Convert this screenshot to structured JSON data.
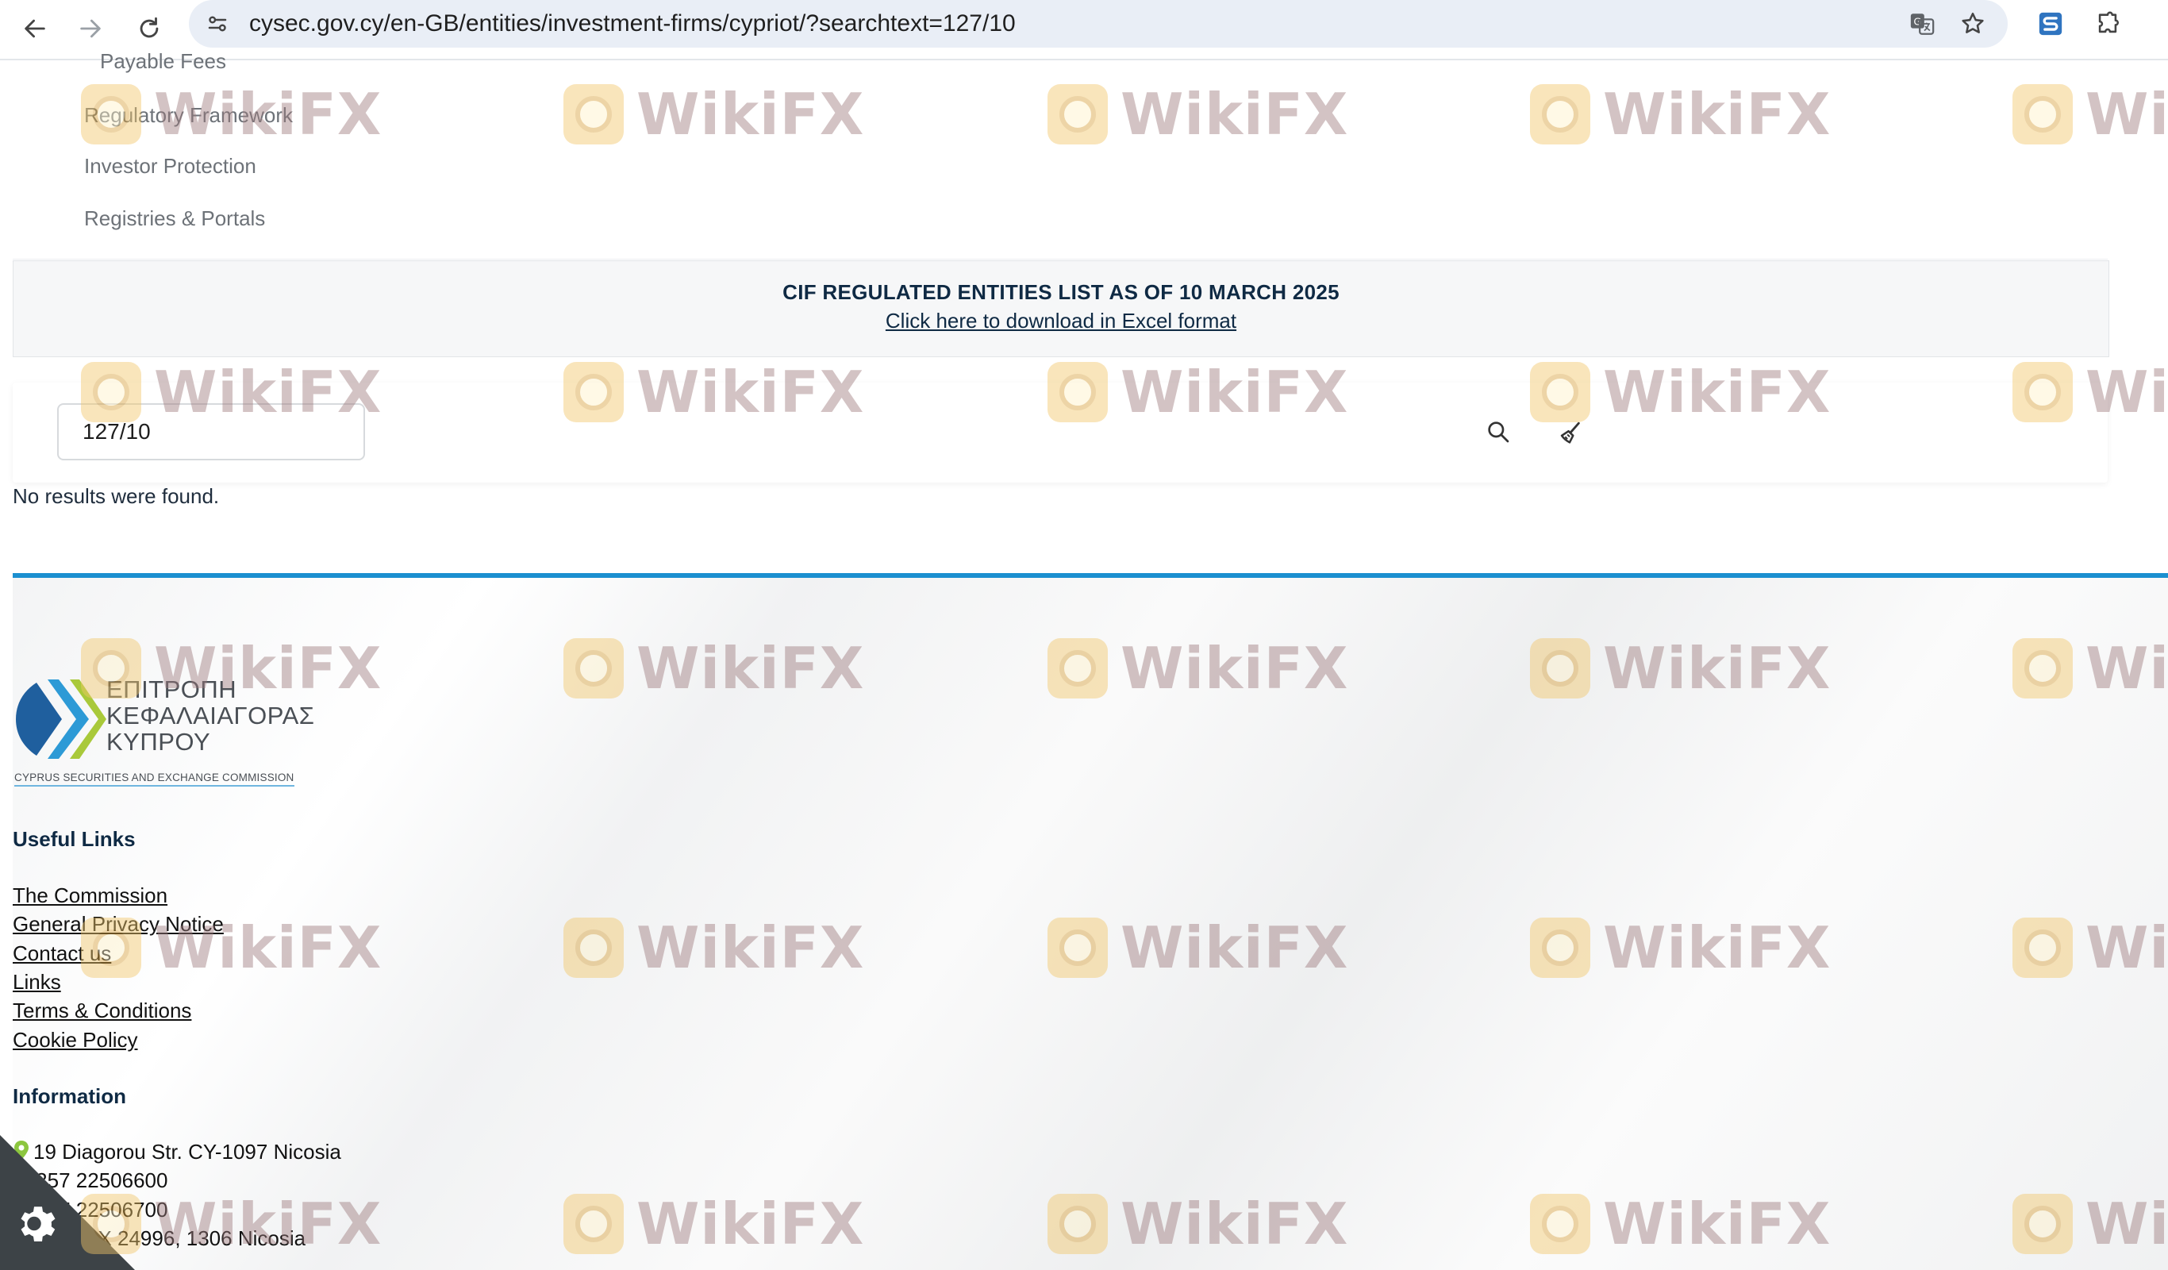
{
  "browser": {
    "url": "cysec.gov.cy/en-GB/entities/investment-firms/cypriot/?searchtext=127/10"
  },
  "menu": {
    "items": [
      "Payable Fees",
      "Regulatory Framework",
      "Investor Protection",
      "Registries & Portals"
    ]
  },
  "notice": {
    "title": "CIF REGULATED ENTITIES LIST AS OF 10 MARCH 2025",
    "download_link": "Click here to download in Excel format"
  },
  "search": {
    "value": "127/10",
    "no_results": "No results were found."
  },
  "footer": {
    "logo": {
      "greek_lines": [
        "ΕΠΙΤΡΟΠΗ",
        "ΚΕΦΑΛΑΙΑΓΟΡΑΣ",
        "ΚΥΠΡΟΥ"
      ],
      "english": "CYPRUS SECURITIES AND EXCHANGE COMMISSION"
    },
    "useful_links_heading": "Useful Links",
    "useful_links": [
      "The Commission",
      "General Privacy Notice",
      "Contact us",
      "Links",
      "Terms & Conditions",
      "Cookie Policy"
    ],
    "information_heading": "Information",
    "address": "19 Diagorou Str. CY-1097 Nicosia",
    "phone": "+357 22506600",
    "fax": "+357 22506700",
    "po_box": "P.O. BOX 24996, 1306 Nicosia"
  },
  "watermark": {
    "text": "WikiFX"
  },
  "colors": {
    "accent": "#1b8fd0",
    "text_dark": "#0f2a44",
    "cookie_badge": "#3d4347"
  }
}
